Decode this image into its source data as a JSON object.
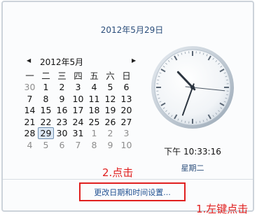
{
  "header": {
    "full_date": "2012年5月29日"
  },
  "calendar": {
    "month_label": "2012年5月",
    "prev_glyph": "◀",
    "next_glyph": "▶",
    "weekdays": [
      "一",
      "二",
      "三",
      "四",
      "五",
      "六",
      "日"
    ],
    "weeks": [
      [
        "30",
        "1",
        "2",
        "3",
        "4",
        "5",
        "6"
      ],
      [
        "7",
        "8",
        "9",
        "10",
        "11",
        "12",
        "13"
      ],
      [
        "14",
        "15",
        "16",
        "17",
        "18",
        "19",
        "20"
      ],
      [
        "21",
        "22",
        "23",
        "24",
        "25",
        "26",
        "27"
      ],
      [
        "28",
        "29",
        "30",
        "31",
        "1",
        "2",
        "3"
      ],
      [
        "4",
        "5",
        "6",
        "7",
        "8",
        "9",
        "10"
      ]
    ],
    "selected_day": "29"
  },
  "clock": {
    "time": "下午 10:33:16",
    "weekday": "星期二",
    "hour": 10,
    "minute": 33,
    "second": 16
  },
  "link": {
    "label": "更改日期和时间设置..."
  },
  "annotations": {
    "step2": "2.点击",
    "step1": "1.左键点击"
  },
  "colors": {
    "accent": "#2b4e7b",
    "annotation": "#e0201f",
    "link": "#1f4f91"
  }
}
